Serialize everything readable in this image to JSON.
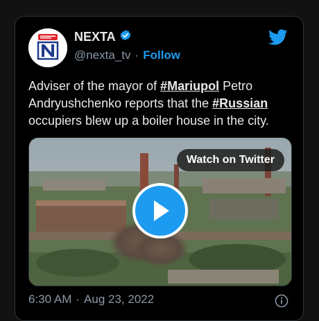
{
  "account": {
    "name": "NEXTA",
    "handle": "@nexta_tv",
    "separator": "·",
    "follow_label": "Follow",
    "verified": true
  },
  "tweet": {
    "text_1": "Adviser of the mayor of ",
    "hashtag_1": "#Mariupol",
    "text_2": " Petro Andryushchenko reports that the ",
    "hashtag_2": "#Russian",
    "text_3": " occupiers blew up a boiler house in the city."
  },
  "media": {
    "watch_label": "Watch on Twitter",
    "play_icon": "play-icon"
  },
  "footer": {
    "time": "6:30 AM",
    "separator": "·",
    "date": "Aug 23, 2022"
  },
  "colors": {
    "accent": "#1d9bf0",
    "text": "#e7e9ea",
    "muted": "#8b98a5",
    "background": "#000000"
  }
}
